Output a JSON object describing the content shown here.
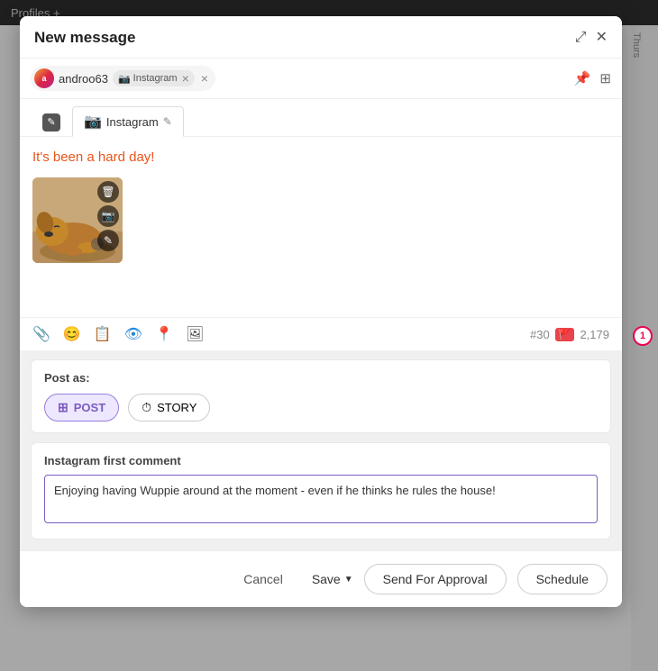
{
  "background": {
    "topbar_text": "Profiles +"
  },
  "modal": {
    "title": "New message",
    "expand_label": "expand",
    "close_label": "close",
    "recipient": {
      "name": "androo63",
      "platform": "Instagram",
      "close_label": "×"
    },
    "tab": {
      "label": "Instagram",
      "edit_label": "✎"
    },
    "message": {
      "text": "It's been a hard day!",
      "image_alt": "Dog sleeping"
    },
    "toolbar": {
      "char_tag": "#30",
      "char_count": "2,179"
    },
    "post_as": {
      "label": "Post as:",
      "options": [
        {
          "id": "post",
          "label": "POST",
          "active": true
        },
        {
          "id": "story",
          "label": "STORY",
          "active": false
        }
      ]
    },
    "first_comment": {
      "label": "Instagram first comment",
      "value": "Enjoying having Wuppie around at the moment - even if he thinks he rules the house!"
    },
    "footer": {
      "cancel_label": "Cancel",
      "save_label": "Save",
      "send_approval_label": "Send For Approval",
      "schedule_label": "Schedule"
    }
  },
  "notification": {
    "count": "1"
  }
}
